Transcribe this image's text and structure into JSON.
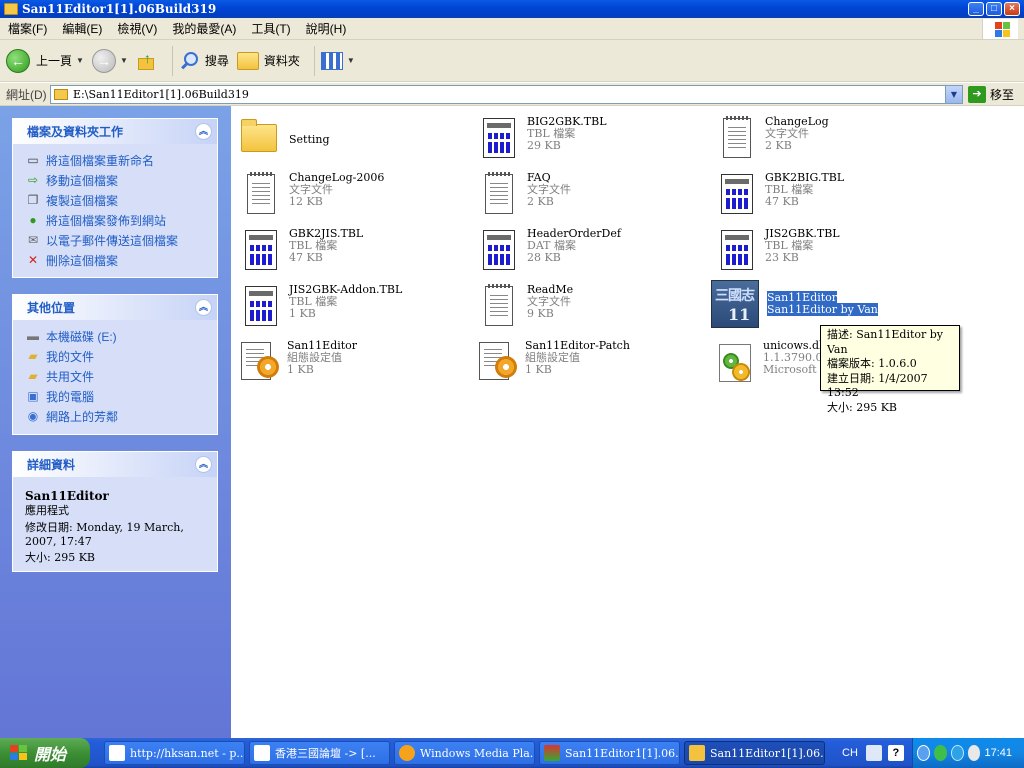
{
  "window": {
    "title": "San11Editor1[1].06Build319"
  },
  "menu": [
    "檔案(F)",
    "編輯(E)",
    "檢視(V)",
    "我的最愛(A)",
    "工具(T)",
    "說明(H)"
  ],
  "toolbar": {
    "back": "上一頁",
    "search": "搜尋",
    "folders": "資料夾"
  },
  "address": {
    "label": "網址(D)",
    "value": "E:\\San11Editor1[1].06Build319",
    "go": "移至"
  },
  "tasks_panel": {
    "title": "檔案及資料夾工作",
    "items": [
      "將這個檔案重新命名",
      "移動這個檔案",
      "複製這個檔案",
      "將這個檔案發佈到網站",
      "以電子郵件傳送這個檔案",
      "刪除這個檔案"
    ]
  },
  "places_panel": {
    "title": "其他位置",
    "items": [
      "本機磁碟 (E:)",
      "我的文件",
      "共用文件",
      "我的電腦",
      "網路上的芳鄰"
    ]
  },
  "details_panel": {
    "title": "詳細資料",
    "name": "San11Editor",
    "type": "應用程式",
    "modified": "修改日期: Monday, 19 March, 2007, 17:47",
    "size": "大小: 295 KB"
  },
  "files": [
    {
      "name": "Setting",
      "type": "",
      "size": "",
      "icon": "folder-icon"
    },
    {
      "name": "BIG2GBK.TBL",
      "type": "TBL 檔案",
      "size": "29 KB",
      "icon": "tbl-file-icon"
    },
    {
      "name": "ChangeLog",
      "type": "文字文件",
      "size": "2 KB",
      "icon": "text-file-icon"
    },
    {
      "name": "ChangeLog-2006",
      "type": "文字文件",
      "size": "12 KB",
      "icon": "text-file-icon"
    },
    {
      "name": "FAQ",
      "type": "文字文件",
      "size": "2 KB",
      "icon": "text-file-icon"
    },
    {
      "name": "GBK2BIG.TBL",
      "type": "TBL 檔案",
      "size": "47 KB",
      "icon": "tbl-file-icon"
    },
    {
      "name": "GBK2JIS.TBL",
      "type": "TBL 檔案",
      "size": "47 KB",
      "icon": "tbl-file-icon"
    },
    {
      "name": "HeaderOrderDef",
      "type": "DAT 檔案",
      "size": "28 KB",
      "icon": "tbl-file-icon"
    },
    {
      "name": "JIS2GBK.TBL",
      "type": "TBL 檔案",
      "size": "23 KB",
      "icon": "tbl-file-icon"
    },
    {
      "name": "JIS2GBK-Addon.TBL",
      "type": "TBL 檔案",
      "size": "1 KB",
      "icon": "tbl-file-icon"
    },
    {
      "name": "ReadMe",
      "type": "文字文件",
      "size": "9 KB",
      "icon": "text-file-icon"
    },
    {
      "name": "San11Editor",
      "type": "San11Editor by Van",
      "size": "",
      "icon": "app-icon"
    },
    {
      "name": "San11Editor",
      "type": "組態設定值",
      "size": "1 KB",
      "icon": "config-file-icon"
    },
    {
      "name": "San11Editor-Patch",
      "type": "組態設定值",
      "size": "1 KB",
      "icon": "config-file-icon"
    },
    {
      "name": "unicows.dll",
      "type": "1.1.3790.0",
      "size": "Microsoft L",
      "icon": "dll-file-icon"
    }
  ],
  "app_icon_text": {
    "line1": "三國志",
    "line2": "11"
  },
  "tooltip": {
    "line1": "描述: San11Editor by Van",
    "line2": "檔案版本: 1.0.6.0",
    "line3": "建立日期: 1/4/2007 13:52",
    "line4": "大小: 295 KB"
  },
  "taskbar": {
    "start": "開始",
    "tasks": [
      "http://hksan.net - p...",
      "香港三國論壇 -> [...",
      "Windows Media Pla...",
      "San11Editor1[1].06...",
      "San11Editor1[1].06..."
    ],
    "lang": "CH",
    "clock": "17:41"
  }
}
